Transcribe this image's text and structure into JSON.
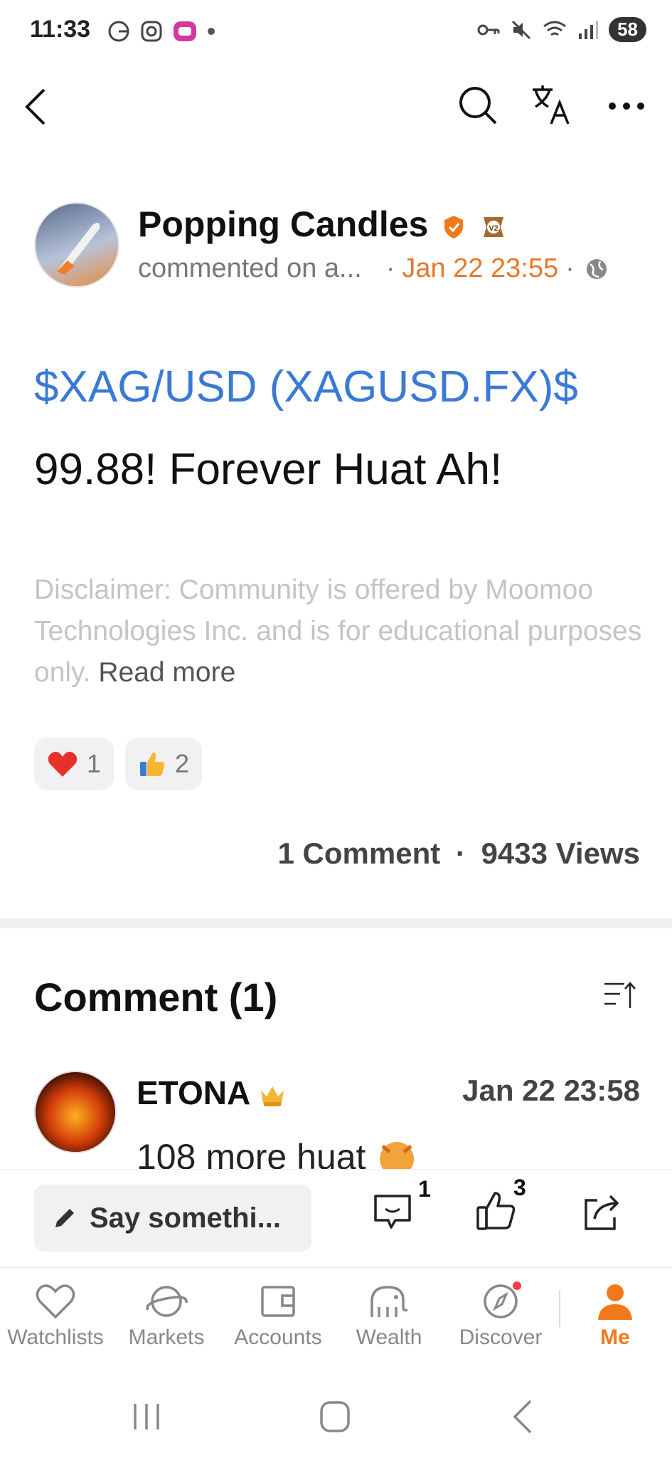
{
  "status_bar": {
    "time": "11:33",
    "battery": "58"
  },
  "post": {
    "author": "Popping Candles",
    "subtitle": "commented on a...",
    "date": "Jan 22 23:55",
    "ticker": "$XAG/USD (XAGUSD.FX)$",
    "body": "99.88! Forever Huat Ah!",
    "disclaimer": "Disclaimer: Community is offered by Moomoo Technologies Inc. and is for educational purposes only.",
    "read_more": "Read more",
    "reactions": [
      {
        "icon": "heart-emoji",
        "count": "1"
      },
      {
        "icon": "thumbs-up-emoji",
        "count": "2"
      }
    ],
    "comments_count": "1 Comment",
    "views": "9433 Views"
  },
  "comments": {
    "title": "Comment (1)",
    "items": [
      {
        "name": "ETONA",
        "date": "Jan 22 23:58",
        "text": "108 more huat"
      }
    ]
  },
  "input_bar": {
    "placeholder": "Say somethi...",
    "comment_badge": "1",
    "like_badge": "3"
  },
  "tabs": [
    {
      "label": "Watchlists",
      "icon": "heart-icon"
    },
    {
      "label": "Markets",
      "icon": "planet-icon"
    },
    {
      "label": "Accounts",
      "icon": "wallet-icon"
    },
    {
      "label": "Wealth",
      "icon": "elephant-icon"
    },
    {
      "label": "Discover",
      "icon": "compass-icon"
    },
    {
      "label": "Me",
      "icon": "person-icon"
    }
  ],
  "colors": {
    "accent": "#f07a1b",
    "link": "#3a7ad5"
  }
}
